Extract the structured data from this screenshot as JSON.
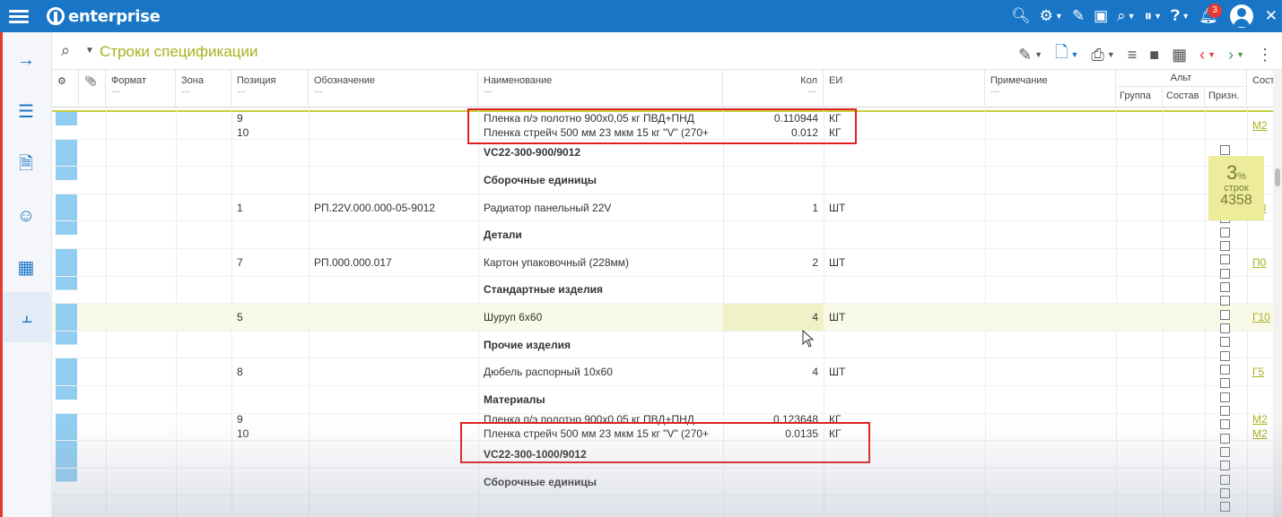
{
  "app": {
    "logo_text": "enterprise",
    "notification_count": "3"
  },
  "toolbar": {
    "title": "Строки спецификации"
  },
  "columns": {
    "format": "Формат",
    "zone": "Зона",
    "position": "Позиция",
    "designation": "Обозначение",
    "name": "Наименование",
    "qty": "Кол",
    "unit": "ЕИ",
    "note": "Примечание",
    "alt": "Альт",
    "group": "Группа",
    "composition": "Состав",
    "sign": "Призн.",
    "sost": "Сост",
    "dots": "…"
  },
  "progress": {
    "percent": "3",
    "percent_sign": "%",
    "label": "строк",
    "count": "4358"
  },
  "rows": [
    {
      "pos": "9\n10",
      "pos1": "9",
      "pos2": "10",
      "name1": "Пленка п/э полотно 900х0,05 кг ПВД+ПНД",
      "name2": "Пленка стрейч 500 мм 23 мкм 15 кг \"V\" (270+",
      "qty1": "0.110944",
      "qty2": "0.012",
      "unit1": "КГ",
      "unit2": "КГ",
      "link": "М2"
    },
    {
      "name": "VC22-300-900/9012"
    },
    {
      "name": "Сборочные единицы"
    },
    {
      "pos": "1",
      "designation": "РП.22V.000.000-05-9012",
      "name": "Радиатор панельный 22V",
      "qty": "1",
      "unit": "ШТ",
      "link": "П0"
    },
    {
      "name": "Детали"
    },
    {
      "pos": "7",
      "designation": "РП.000.000.017",
      "name": "Картон упаковочный (228мм)",
      "qty": "2",
      "unit": "ШТ",
      "link": "П0"
    },
    {
      "name": "Стандартные изделия"
    },
    {
      "pos": "5",
      "name": "Шуруп 6х60",
      "qty": "4",
      "unit": "ШТ",
      "link": "Г10"
    },
    {
      "name": "Прочие изделия"
    },
    {
      "pos": "8",
      "name": "Дюбель распорный 10х60",
      "qty": "4",
      "unit": "ШТ",
      "link": "Г5"
    },
    {
      "name": "Материалы"
    },
    {
      "pos1": "9",
      "pos2": "10",
      "name1": "Пленка п/э полотно 900х0,05 кг ПВД+ПНД",
      "name2": "Пленка стрейч 500 мм 23 мкм 15 кг \"V\" (270+",
      "qty1": "0.123648",
      "qty2": "0.0135",
      "unit1": "КГ",
      "unit2": "КГ",
      "link1": "М2",
      "link2": "М2"
    },
    {
      "name": "VC22-300-1000/9012"
    },
    {
      "name": "Сборочные единицы"
    }
  ]
}
